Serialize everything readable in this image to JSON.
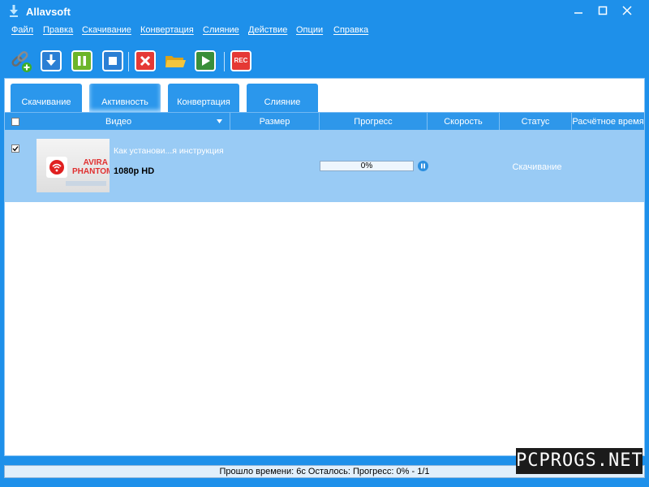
{
  "window": {
    "title": "Allavsoft"
  },
  "menu": [
    "Файл",
    "Правка",
    "Скачивание",
    "Конвертация",
    "Слияние",
    "Действие",
    "Опции",
    "Справка"
  ],
  "toolbar": {
    "rec_label": "REC"
  },
  "tabs": [
    "Скачивание",
    "Активность",
    "Конвертация",
    "Слияние"
  ],
  "columns": [
    "Видео",
    "Размер",
    "Прогресс",
    "Скорость",
    "Статус",
    "Расчётное время"
  ],
  "row": {
    "title": "Как установи...я инструкция",
    "quality": "1080p HD",
    "progress": "0%",
    "progress_value": 0,
    "status": "Скачивание",
    "thumb_brand_line1": "AVIRA",
    "thumb_brand_line2": "PHANTOM"
  },
  "statusbar": {
    "text": "Прошло времени: 6с Осталось: Прогресс: 0% - 1/1"
  },
  "watermark": "PCPROGS.NET",
  "colors": {
    "frame": "#1e90ea",
    "row_selected": "#99cbf5",
    "pause": "#f0b400",
    "stop": "#e53935",
    "play": "#2e8b57"
  }
}
